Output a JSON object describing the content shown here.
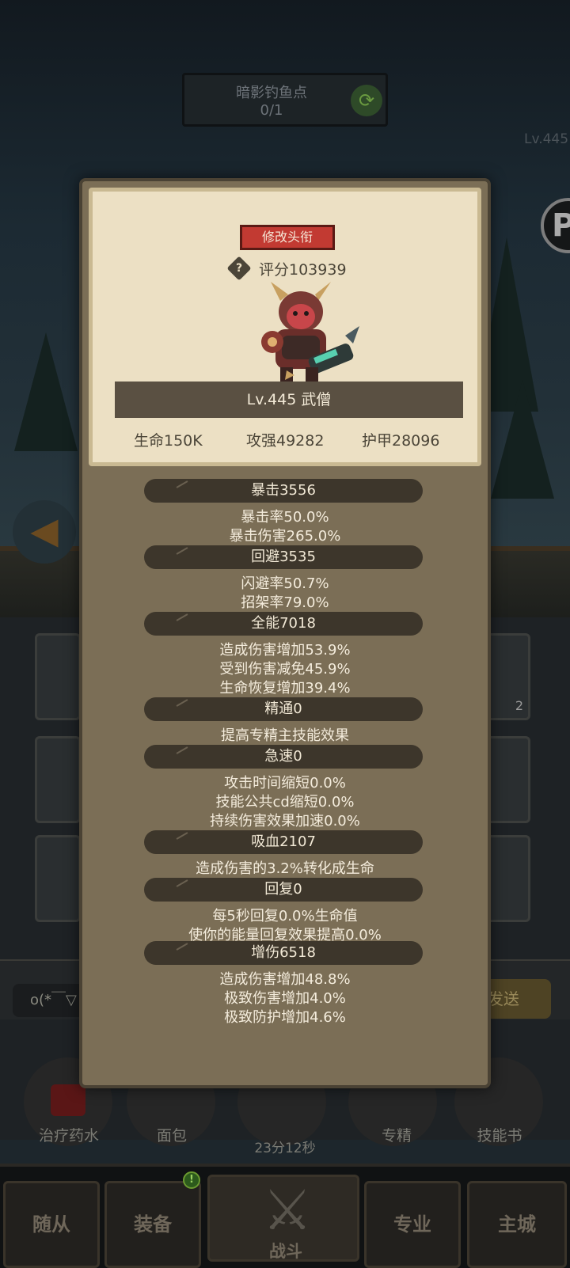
{
  "background": {
    "location_name": "暗影钓鱼点",
    "location_count": "0/1",
    "level_hint": "Lv.445",
    "p_icon": "P",
    "chat_placeholder": "o(*￣▽",
    "send_label": "发送",
    "timer": "23分12秒",
    "items": [
      {
        "label": "治疗药水",
        "icon": "potion-icon"
      },
      {
        "label": "面包",
        "icon": "bread-icon"
      },
      {
        "label": "",
        "icon": "chest-icon"
      },
      {
        "label": "专精",
        "icon": "specialty-icon"
      },
      {
        "label": "技能书",
        "icon": "skill-book-icon"
      }
    ],
    "slot_badge": "2"
  },
  "nav": {
    "tabs": [
      "随从",
      "装备",
      "战斗",
      "专业",
      "主城"
    ],
    "badge": "!"
  },
  "panel": {
    "title_button": "修改头衔",
    "score": "评分103939",
    "hero": "Lv.445 武僧",
    "stats": {
      "hp": "生命150K",
      "attack": "攻强49282",
      "armor": "护甲28096"
    },
    "sections": [
      {
        "title": "暴击3556",
        "lines": [
          "暴击率50.0%",
          "暴击伤害265.0%"
        ]
      },
      {
        "title": "回避3535",
        "lines": [
          "闪避率50.7%",
          "招架率79.0%"
        ]
      },
      {
        "title": "全能7018",
        "lines": [
          "造成伤害增加53.9%",
          "受到伤害减免45.9%",
          "生命恢复增加39.4%"
        ]
      },
      {
        "title": "精通0",
        "lines": [
          "提高专精主技能效果"
        ]
      },
      {
        "title": "急速0",
        "lines": [
          "攻击时间缩短0.0%",
          "技能公共cd缩短0.0%",
          "持续伤害效果加速0.0%"
        ]
      },
      {
        "title": "吸血2107",
        "lines": [
          "造成伤害的3.2%转化成生命"
        ]
      },
      {
        "title": "回复0",
        "lines": [
          "每5秒回复0.0%生命值",
          "使你的能量回复效果提高0.0%"
        ]
      },
      {
        "title": "增伤6518",
        "lines": [
          "造成伤害增加48.8%",
          "极致伤害增加4.0%",
          "极致防护增加4.6%"
        ]
      }
    ]
  }
}
